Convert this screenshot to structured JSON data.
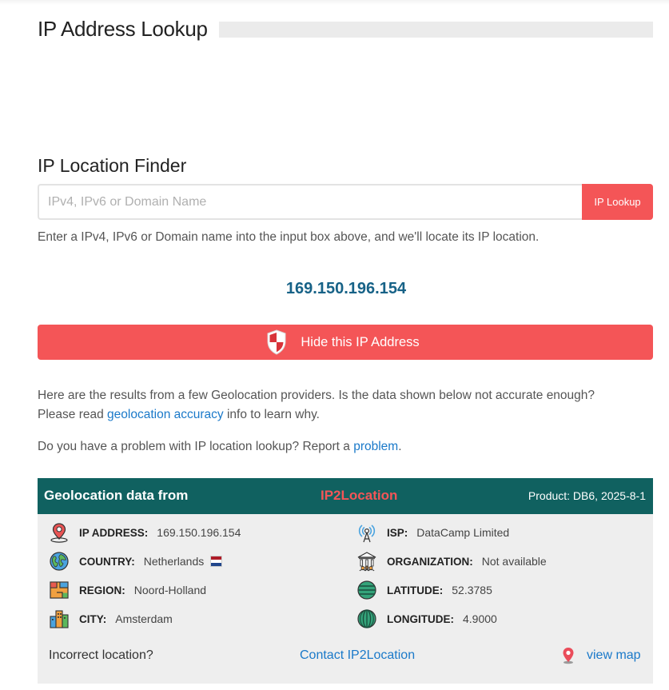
{
  "page": {
    "title": "IP Address Lookup"
  },
  "finder": {
    "title": "IP Location Finder",
    "input_placeholder": "IPv4, IPv6 or Domain Name",
    "input_value": "",
    "button_label": "IP Lookup",
    "hint": "Enter a IPv4, IPv6 or Domain name into the input box above, and we'll locate its IP location."
  },
  "ip_display": "169.150.196.154",
  "hide_button": {
    "label": "Hide this IP Address",
    "icon": "shield-icon"
  },
  "info": {
    "p1_before": "Here are the results from a few Geolocation providers. Is the data shown below not accurate enough?",
    "p1_line2_before": "Please read ",
    "p1_link": "geolocation accuracy",
    "p1_after": " info to learn why.",
    "p2_before": "Do you have a problem with IP location lookup? Report a ",
    "p2_link": "problem",
    "p2_after": "."
  },
  "geo": {
    "header_label": "Geolocation data from",
    "provider": "IP2Location",
    "product": "Product: DB6, 2025-8-1",
    "fields": {
      "ip": {
        "label": "IP ADDRESS:",
        "value": "169.150.196.154",
        "icon": "ip-address-icon"
      },
      "country": {
        "label": "COUNTRY:",
        "value": "Netherlands",
        "icon": "globe-icon"
      },
      "region": {
        "label": "REGION:",
        "value": "Noord-Holland",
        "icon": "region-map-icon"
      },
      "city": {
        "label": "CITY:",
        "value": "Amsterdam",
        "icon": "city-icon"
      },
      "isp": {
        "label": "ISP:",
        "value": "DataCamp Limited",
        "icon": "antenna-icon"
      },
      "organization": {
        "label": "ORGANIZATION:",
        "value": "Not available",
        "icon": "organization-icon"
      },
      "latitude": {
        "label": "LATITUDE:",
        "value": "52.3785",
        "icon": "latitude-icon"
      },
      "longitude": {
        "label": "LONGITUDE:",
        "value": "4.9000",
        "icon": "longitude-icon"
      }
    },
    "footer": {
      "incorrect": "Incorrect location?",
      "contact": "Contact IP2Location",
      "view_map": "view map"
    }
  },
  "colors": {
    "accent_red": "#f45557",
    "header_teal": "#106160",
    "link_blue": "#1a79c9",
    "ip_blue": "#176287"
  }
}
